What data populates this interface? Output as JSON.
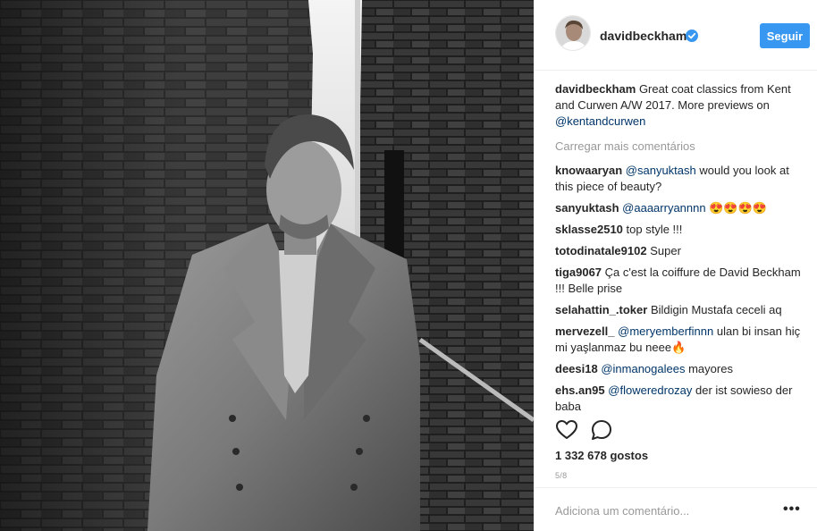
{
  "post": {
    "username": "davidbeckham",
    "follow_label": "Seguir",
    "caption": {
      "username": "davidbeckham",
      "text": " Great coat classics from Kent and Curwen A/W 2017. More previews on ",
      "mention": "@kentandcurwen"
    },
    "load_more": "Carregar mais comentários",
    "comments": [
      {
        "user": "knowaaryan",
        "mention": "@sanyuktash",
        "text": " would you look at this piece of beauty?"
      },
      {
        "user": "sanyuktash",
        "mention": "@aaaarryannnn",
        "text": " 😍😍😍😍"
      },
      {
        "user": "sklasse2510",
        "mention": "",
        "text": " top style !!!"
      },
      {
        "user": "totodinatale9102",
        "mention": "",
        "text": " Super"
      },
      {
        "user": "tiga9067",
        "mention": "",
        "text": " Ça c'est la coiffure de David Beckham !!! Belle prise"
      },
      {
        "user": "selahattin_.toker",
        "mention": "",
        "text": " Bildigin Mustafa ceceli aq"
      },
      {
        "user": "mervezell_",
        "mention": "@meryemberfinnn",
        "text": " ulan bi insan hiç mi yaşlanmaz bu neee🔥"
      },
      {
        "user": "deesi18",
        "mention": "@inmanogalees",
        "text": " mayores"
      },
      {
        "user": "ehs.an95",
        "mention": "@floweredrozay",
        "text": " der ist sowieso der baba"
      }
    ],
    "likes": "1 332 678 gostos",
    "date": "5/8",
    "add_comment_placeholder": "Adiciona um comentário...",
    "more_label": "•••",
    "icons": {
      "verified": "verified-badge-icon",
      "like": "heart-icon",
      "comment": "speech-bubble-icon",
      "more": "ellipsis-icon"
    },
    "colors": {
      "follow": "#3897f0",
      "mention": "#003569",
      "muted": "#999999",
      "verified": "#3897f0"
    }
  }
}
